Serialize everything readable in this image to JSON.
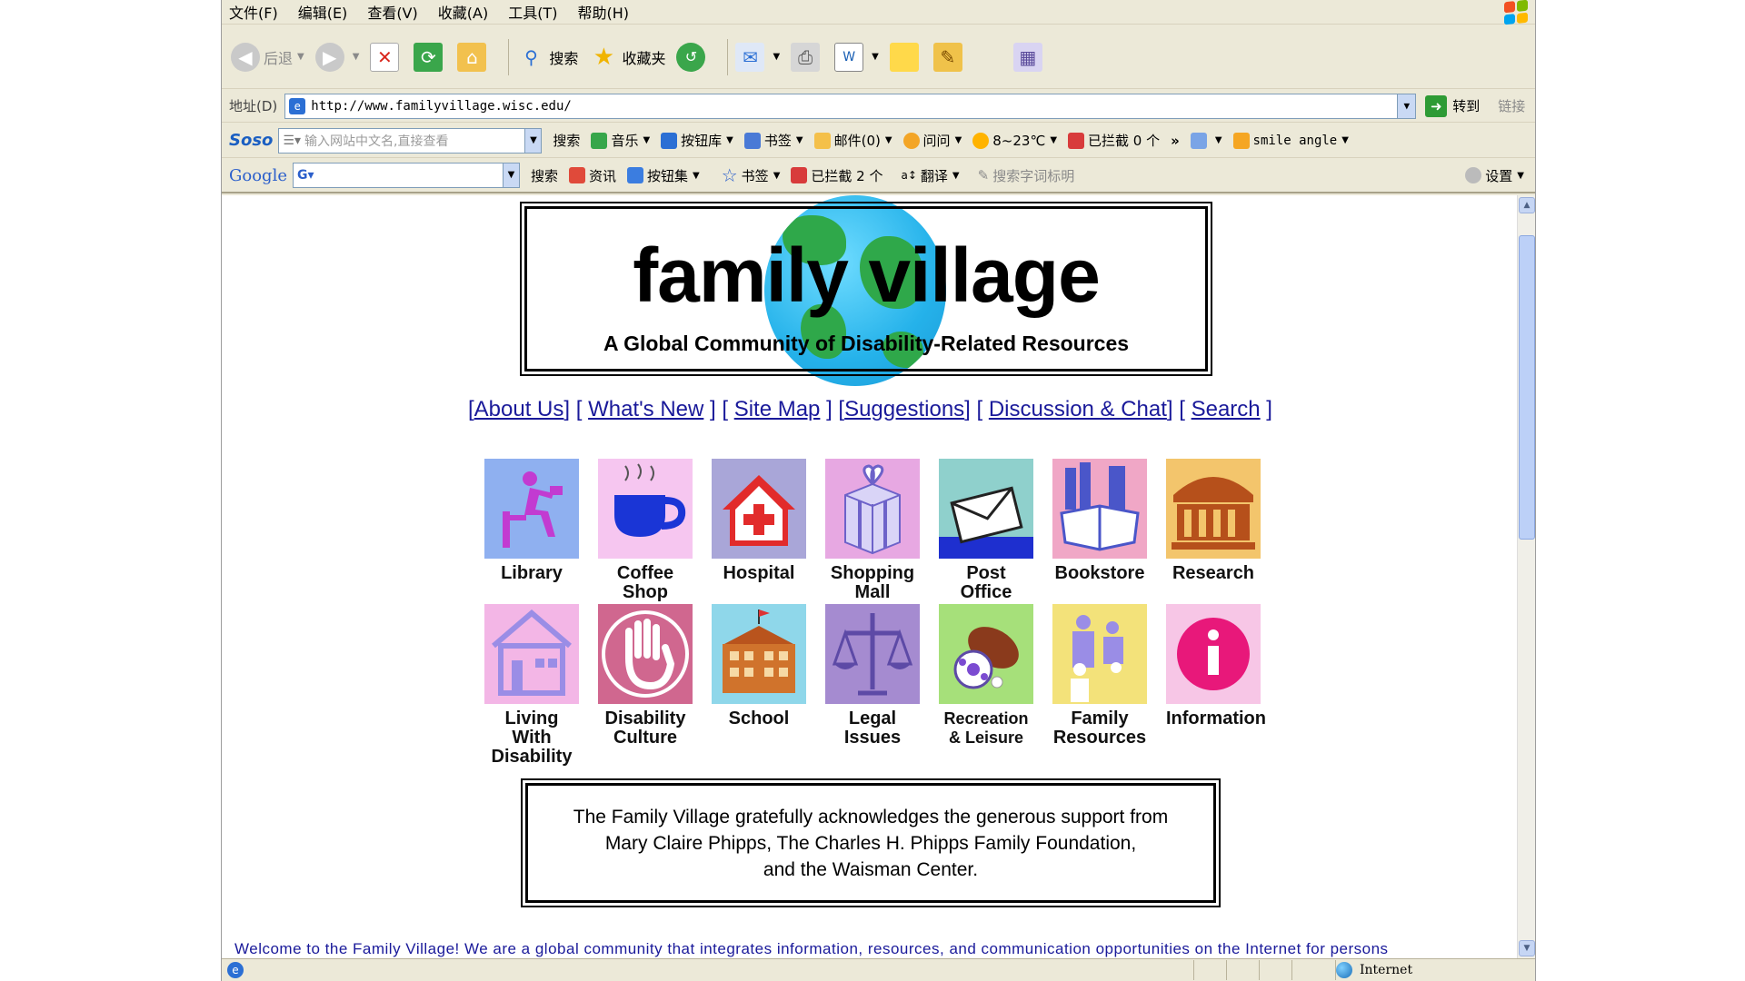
{
  "menu": [
    "文件(F)",
    "编辑(E)",
    "查看(V)",
    "收藏(A)",
    "工具(T)",
    "帮助(H)"
  ],
  "toolbar": {
    "back": "后退",
    "search": "搜索",
    "favorites": "收藏夹"
  },
  "address": {
    "label": "地址(D)",
    "url": "http://www.familyvillage.wisc.edu/",
    "go": "转到",
    "links": "链接"
  },
  "soso": {
    "logo": "Soso",
    "placeholder": "输入网站中文名,直接查看",
    "search": "搜索",
    "music": "音乐",
    "buttons": "按钮库",
    "bookmarks": "书签",
    "mail": "邮件(0)",
    "ask": "问问",
    "weather": "8~23℃",
    "blocked": "已拦截 0 个",
    "more": "»",
    "user": "smile angle"
  },
  "google": {
    "logo": "Google",
    "search": "搜索",
    "news": "资讯",
    "buttons": "按钮集",
    "bookmarks": "书签",
    "blocked": "已拦截 2 个",
    "translate": "翻译",
    "highlight": "搜索字词标明",
    "settings": "设置"
  },
  "page": {
    "logo_title": "family village",
    "logo_subtitle": "A Global Community of Disability-Related Resources",
    "nav": [
      "About Us",
      "What's New",
      "Site Map",
      "Suggestions",
      "Discussion & Chat",
      "Search"
    ],
    "icons_row1": [
      "Library",
      "Coffee Shop",
      "Hospital",
      "Shopping Mall",
      "Post Office",
      "Bookstore",
      "Research"
    ],
    "icons_row2": [
      "Living With Disability",
      "Disability Culture",
      "School",
      "Legal Issues",
      "Recreation & Leisure",
      "Family Resources",
      "Information"
    ],
    "ack_lines": [
      "The Family Village gratefully acknowledges the generous support from",
      "Mary Claire Phipps, The Charles H. Phipps Family Foundation,",
      "and the Waisman Center."
    ],
    "welcome": "Welcome to the Family Village! We are a global community that integrates information, resources, and communication opportunities on the Internet for persons"
  },
  "status": {
    "zone": "Internet"
  },
  "colors": {
    "link": "#1a1a9a",
    "globe": "#25b2ea",
    "land": "#2fa84a"
  }
}
